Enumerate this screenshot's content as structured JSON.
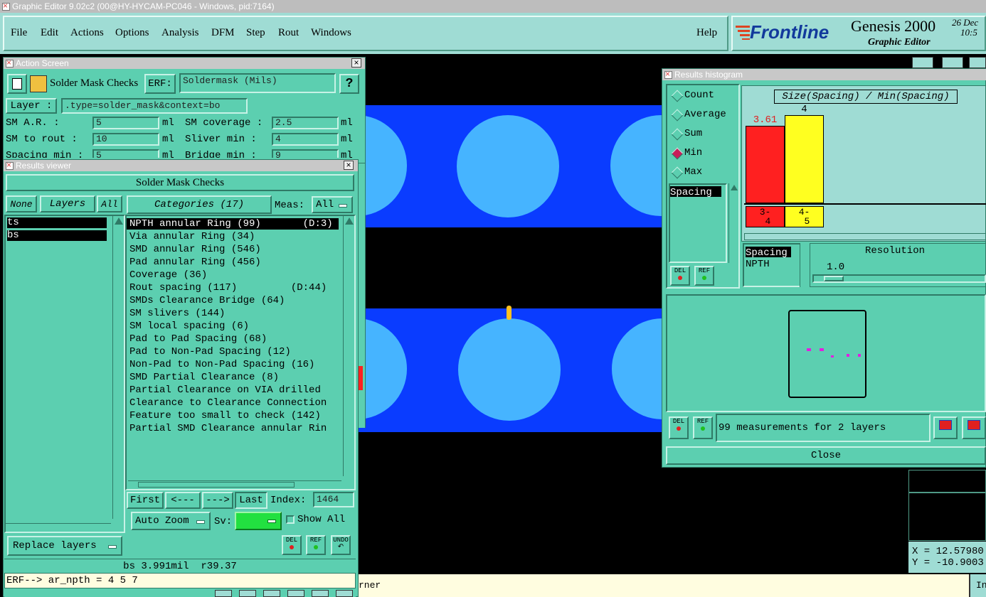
{
  "main_window": {
    "title": "Graphic Editor 9.02c2 (00@HY-HYCAM-PC046 - Windows, pid:7164)",
    "menu": [
      "File",
      "Edit",
      "Actions",
      "Options",
      "Analysis",
      "DFM",
      "Step",
      "Rout",
      "Windows"
    ],
    "help": "Help",
    "brand": "Frontline",
    "product": "Genesis 2000",
    "product_sub": "Graphic Editor",
    "date": "26 Dec",
    "time": "10:5",
    "coord_x": "X = 12.57980",
    "coord_y": "Y = -10.9003",
    "status_text": "rner",
    "status_right": "In"
  },
  "action_screen": {
    "title": "Action Screen",
    "check_name": "Solder Mask Checks",
    "erf_label": "ERF:",
    "erf_value": "Soldermask (Mils)",
    "help_btn": "?",
    "layer_label": "Layer :",
    "layer_value": ".type=solder_mask&context=bo",
    "params": [
      {
        "label": "SM A.R.     :",
        "value": "5",
        "unit": "ml",
        "label2": "SM coverage :",
        "value2": "2.5",
        "unit2": "ml"
      },
      {
        "label": "SM to rout  :",
        "value": "10",
        "unit": "ml",
        "label2": "Sliver  min :",
        "value2": "4",
        "unit2": "ml"
      },
      {
        "label": "Spacing min :",
        "value": "5",
        "unit": "ml",
        "label2": "Bridge  min :",
        "value2": "9",
        "unit2": "ml"
      }
    ]
  },
  "results_viewer": {
    "title": "Results viewer",
    "header": "Solder Mask Checks",
    "btn_none": "None",
    "btn_layers": "Layers",
    "btn_all": "All",
    "layers": [
      "ts",
      "bs"
    ],
    "categories_btn": "Categories (17)",
    "meas_label": "Meas:",
    "meas_value": "All",
    "categories": [
      "NPTH annular Ring (99)       (D:3)",
      "Via annular Ring (34)",
      "SMD annular Ring (546)",
      "Pad annular Ring (456)",
      "Coverage (36)",
      "Rout spacing (117)         (D:44)",
      "SMDs Clearance Bridge (64)",
      "SM slivers (144)",
      "SM local spacing (6)",
      "Pad to Pad Spacing (68)",
      "Pad to Non-Pad Spacing (12)",
      "Non-Pad to Non-Pad Spacing (16)",
      "SMD Partial Clearance (8)",
      "Partial Clearance on VIA drilled",
      "Clearance to Clearance Connection",
      "Feature too small to check (142)",
      "Partial SMD Clearance annular Rin"
    ],
    "nav": {
      "first": "First",
      "prev": "<---",
      "next": "--->",
      "last": "Last",
      "index_label": "Index:",
      "index_value": "1464"
    },
    "auto_zoom": "Auto Zoom",
    "sv_label": "Sv:",
    "show_all": "Show All",
    "replace_layers": "Replace layers",
    "del": "DEL",
    "ref": "REF",
    "undo": "UNDO",
    "status": "bs 3.991mil  r39.37",
    "erf_line": "ERF--> ar_npth = 4 5 7"
  },
  "histogram": {
    "title": "Results histogram",
    "modes": [
      "Count",
      "Average",
      "Sum",
      "Min",
      "Max"
    ],
    "selected_mode": "Min",
    "list_item": "Spacing",
    "chart_title": "Size(Spacing) / Min(Spacing)",
    "bars": [
      {
        "value_label": "3.61",
        "range": "3-\n 4",
        "level": 0.88,
        "color": "#ff2020"
      },
      {
        "value_label": "4",
        "range": "4-\n 5",
        "level": 1.0,
        "color": "#ffff20"
      }
    ],
    "bottom_list": [
      "Spacing",
      "NPTH"
    ],
    "resolution_label": "Resolution",
    "resolution_value": "1.0",
    "summary": "99 measurements for 2 layers",
    "close": "Close",
    "del": "DEL",
    "ref": "REF"
  },
  "colors": {
    "panel": "#5ccfb0",
    "canvas_blue": "#0a3cff",
    "pad": "#46b4ff"
  }
}
